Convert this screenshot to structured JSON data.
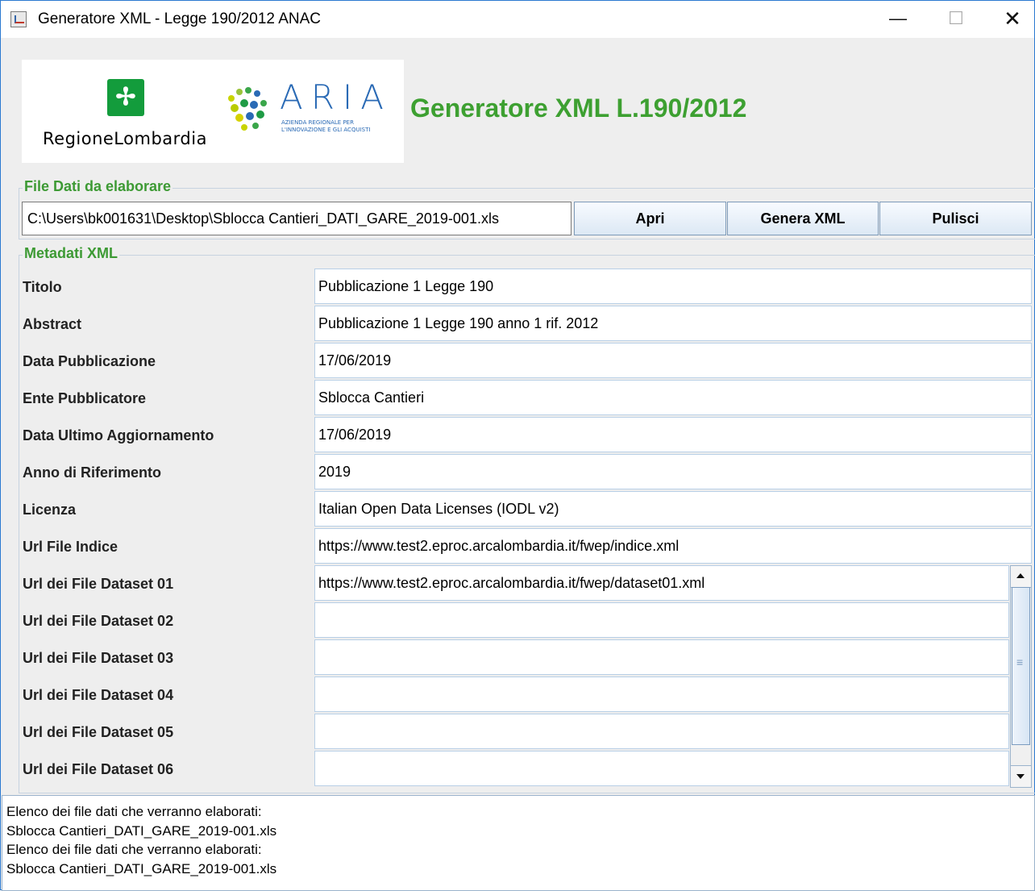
{
  "window": {
    "title": "Generatore XML - Legge 190/2012 ANAC",
    "minimize": "—",
    "maximize": "☐",
    "close": "✕"
  },
  "header": {
    "logo_regione_text": "RegioneLombardia",
    "logo_aria_text": "ARIA",
    "logo_aria_sub1": "AZIENDA REGIONALE PER",
    "logo_aria_sub2": "L'INNOVAZIONE E GLI ACQUISTI",
    "app_title": "Generatore XML L.190/2012",
    "brand_green": "#3da031"
  },
  "file_section": {
    "title": "File Dati da elaborare",
    "path": "C:\\Users\\bk001631\\Desktop\\Sblocca Cantieri_DATI_GARE_2019-001.xls",
    "open_label": "Apri",
    "generate_label": "Genera XML",
    "clear_label": "Pulisci"
  },
  "metadata": {
    "title": "Metadati XML",
    "rows": [
      {
        "label": "Titolo",
        "value": "Pubblicazione 1 Legge 190"
      },
      {
        "label": "Abstract",
        "value": "Pubblicazione 1 Legge 190 anno 1 rif. 2012"
      },
      {
        "label": "Data Pubblicazione",
        "value": "17/06/2019"
      },
      {
        "label": "Ente Pubblicatore",
        "value": "Sblocca Cantieri"
      },
      {
        "label": "Data Ultimo Aggiornamento",
        "value": "17/06/2019"
      },
      {
        "label": "Anno di Riferimento",
        "value": "2019"
      },
      {
        "label": "Licenza",
        "value": "Italian Open Data Licenses (IODL v2)"
      },
      {
        "label": "Url File Indice",
        "value": "https://www.test2.eproc.arcalombardia.it/fwep/indice.xml"
      }
    ],
    "datasets": [
      {
        "label": "Url dei File Dataset 01",
        "value": "https://www.test2.eproc.arcalombardia.it/fwep/dataset01.xml"
      },
      {
        "label": "Url dei File Dataset 02",
        "value": ""
      },
      {
        "label": "Url dei File Dataset 03",
        "value": ""
      },
      {
        "label": "Url dei File Dataset 04",
        "value": ""
      },
      {
        "label": "Url dei File Dataset 05",
        "value": ""
      },
      {
        "label": "Url dei File Dataset 06",
        "value": ""
      }
    ]
  },
  "log": {
    "lines": [
      "Elenco dei file dati che verranno elaborati:",
      "Sblocca Cantieri_DATI_GARE_2019-001.xls",
      "Elenco dei file dati che verranno elaborati:",
      "Sblocca Cantieri_DATI_GARE_2019-001.xls"
    ]
  }
}
